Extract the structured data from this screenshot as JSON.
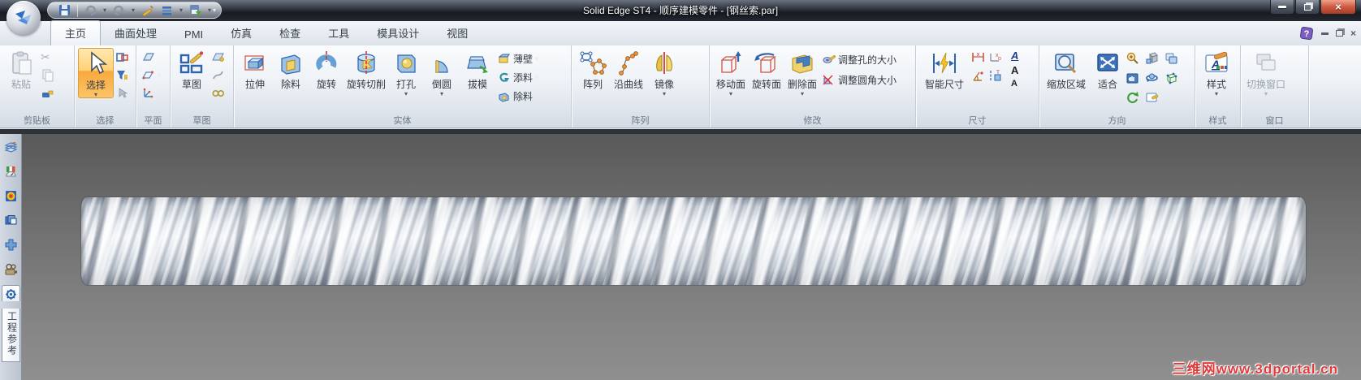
{
  "titlebar": {
    "title": "Solid Edge ST4 - 顺序建模零件 - [钢丝索.par]"
  },
  "tabs": [
    "主页",
    "曲面处理",
    "PMI",
    "仿真",
    "检查",
    "工具",
    "模具设计",
    "视图"
  ],
  "icons": {
    "chevron": "▾",
    "cut_glyph": "✂",
    "close_glyph": "×",
    "help_glyph": "?",
    "letter_a": "A",
    "arrow_up": "▴",
    "arrow_down": "▾"
  },
  "ribbon": {
    "clipboard": {
      "label": "剪贴板",
      "paste": "粘贴"
    },
    "select": {
      "label": "选择",
      "select": "选择"
    },
    "planes": {
      "label": "平面"
    },
    "sketch": {
      "label": "草图",
      "sketch": "草图"
    },
    "solids": {
      "label": "实体",
      "extrude": "拉伸",
      "cut": "除料",
      "revolve": "旋转",
      "revolved_cut": "旋转切削",
      "hole": "打孔",
      "round": "倒圆",
      "draft": "拔模",
      "thin_wall": "薄壁",
      "add_material": "添料",
      "remove_material": "除料"
    },
    "pattern": {
      "label": "阵列",
      "pattern": "阵列",
      "along_curve": "沿曲线",
      "mirror": "镜像"
    },
    "modify": {
      "label": "修改",
      "move_face": "移动面",
      "rotate_face": "旋转面",
      "delete_face": "删除面",
      "resize_holes": "调整孔的大小",
      "resize_rounds": "调整圆角大小"
    },
    "dimension": {
      "label": "尺寸",
      "smart_dimension": "智能尺寸"
    },
    "orient": {
      "label": "方向",
      "zoom_area": "缩放区域",
      "fit": "适合"
    },
    "style": {
      "label": "样式",
      "style": "样式"
    },
    "window": {
      "label": "窗口",
      "switch_window": "切换窗口"
    }
  },
  "edgebar": {
    "selected_tab": "工程参考"
  },
  "viewport": {
    "watermark": "三维网www.3dportal.cn"
  },
  "colors": {
    "accent_orange": "#f8a83c",
    "close_red": "#cf5a41",
    "watermark_red": "#e03a3a",
    "viewport_gray": "#787878"
  }
}
